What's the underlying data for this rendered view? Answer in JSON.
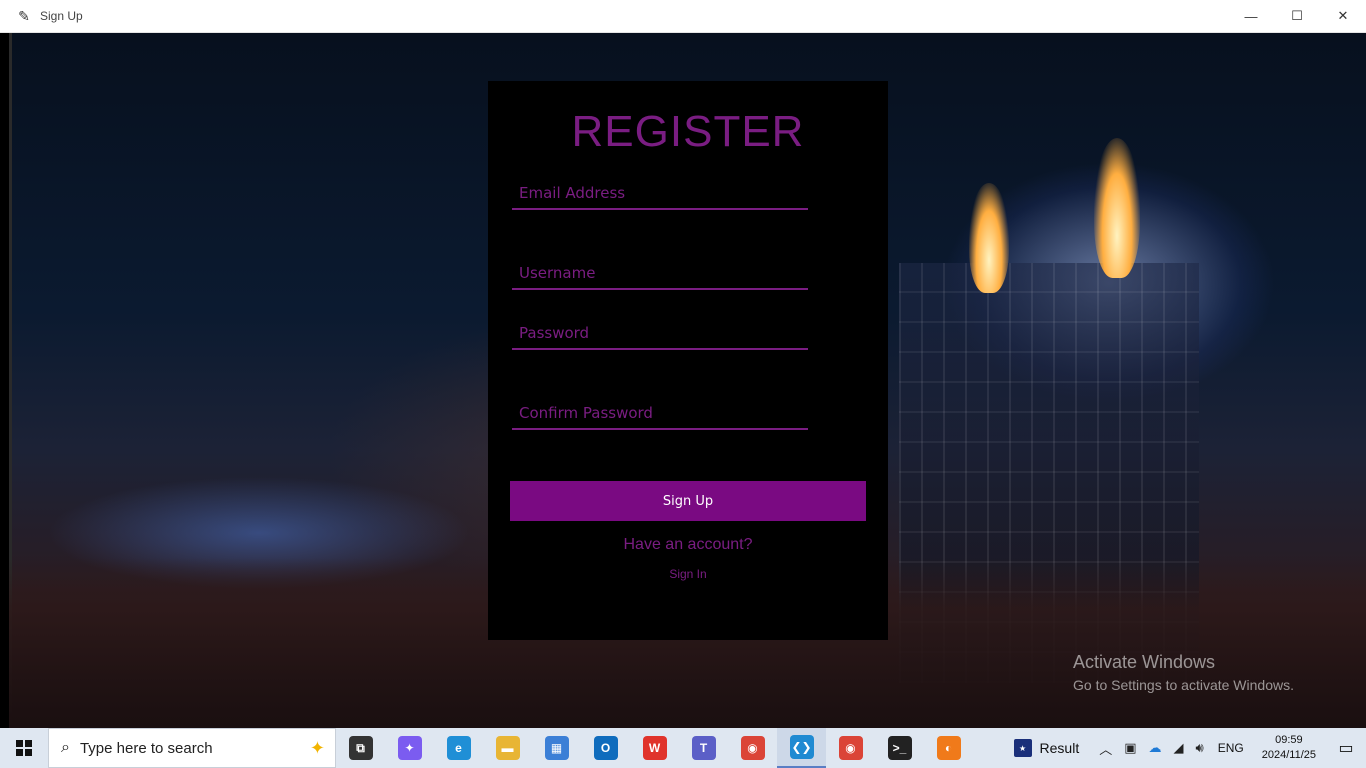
{
  "window": {
    "title": "Sign Up",
    "minimize": "—",
    "maximize": "☐",
    "close": "✕"
  },
  "form": {
    "heading": "REGISTER",
    "email_placeholder": "Email Address",
    "username_placeholder": "Username",
    "password_placeholder": "Password",
    "confirm_placeholder": "Confirm Password",
    "signup_label": "Sign Up",
    "have_account": "Have an account?",
    "signin_label": "Sign In"
  },
  "watermark": {
    "line1": "Activate Windows",
    "line2": "Go to Settings to activate Windows."
  },
  "taskbar": {
    "search_placeholder": "Type here to search",
    "apps": [
      {
        "name": "task-view",
        "glyph": "⧉",
        "color": "#333333"
      },
      {
        "name": "copilot",
        "glyph": "✦",
        "color": "#7b5cf0"
      },
      {
        "name": "edge",
        "glyph": "e",
        "color": "#1f8fd6"
      },
      {
        "name": "file-explorer",
        "glyph": "▬",
        "color": "#e8b534"
      },
      {
        "name": "microsoft-store",
        "glyph": "▦",
        "color": "#3b7fd6"
      },
      {
        "name": "outlook",
        "glyph": "O",
        "color": "#0f6cbd"
      },
      {
        "name": "wps-office",
        "glyph": "W",
        "color": "#e0332b"
      },
      {
        "name": "teams",
        "glyph": "T",
        "color": "#5b5fc7"
      },
      {
        "name": "chrome",
        "glyph": "◉",
        "color": "#db4437"
      },
      {
        "name": "vscode",
        "glyph": "❮❯",
        "color": "#1f8ad2"
      },
      {
        "name": "chrome-2",
        "glyph": "◉",
        "color": "#db4437"
      },
      {
        "name": "terminal",
        "glyph": ">_",
        "color": "#222222"
      },
      {
        "name": "eclipse",
        "glyph": "◐",
        "color": "#f07a1a"
      }
    ],
    "result_label": "Result",
    "language": "ENG",
    "time": "09:59",
    "date": "2024/11/25"
  }
}
